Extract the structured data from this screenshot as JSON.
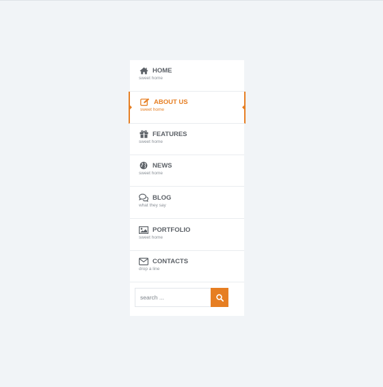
{
  "menu": {
    "items": [
      {
        "label": "HOME",
        "sub": "sweet home",
        "icon": "home-icon"
      },
      {
        "label": "ABOUT US",
        "sub": "sweet home",
        "icon": "edit-icon",
        "active": true
      },
      {
        "label": "FEATURES",
        "sub": "sweet home",
        "icon": "gift-icon"
      },
      {
        "label": "NEWS",
        "sub": "sweet home",
        "icon": "globe-icon"
      },
      {
        "label": "BLOG",
        "sub": "what they say",
        "icon": "comments-icon"
      },
      {
        "label": "PORTFOLIO",
        "sub": "sweet home",
        "icon": "image-icon"
      },
      {
        "label": "CONTACTS",
        "sub": "drop a line",
        "icon": "envelope-icon"
      }
    ]
  },
  "search": {
    "placeholder": "search ...",
    "icon": "search-icon"
  },
  "colors": {
    "accent": "#e67e22",
    "text": "#5c6167",
    "muted": "#8a9097",
    "background": "#f1f4f7",
    "panel": "#ffffff"
  }
}
